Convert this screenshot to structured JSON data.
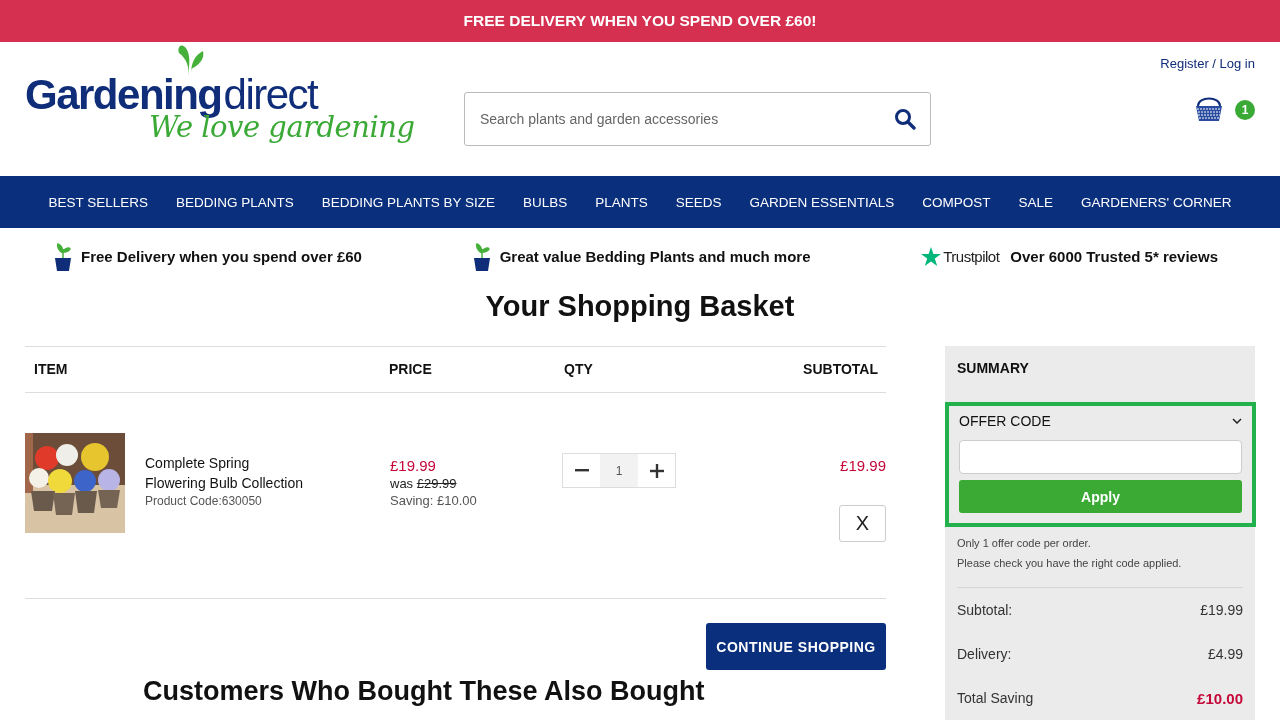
{
  "banner": {
    "text": "FREE DELIVERY WHEN YOU SPEND OVER £60!"
  },
  "header": {
    "logo": {
      "wordmark": "Gardening",
      "suffix": "direct",
      "tagline": "We love gardening"
    },
    "search": {
      "placeholder": "Search plants and garden accessories"
    },
    "account_link": "Register / Log in",
    "basket_count": "1"
  },
  "nav": [
    {
      "label": "BEST SELLERS"
    },
    {
      "label": "BEDDING PLANTS"
    },
    {
      "label": "BEDDING PLANTS BY SIZE"
    },
    {
      "label": "BULBS"
    },
    {
      "label": "PLANTS"
    },
    {
      "label": "SEEDS"
    },
    {
      "label": "GARDEN ESSENTIALS"
    },
    {
      "label": "COMPOST"
    },
    {
      "label": "SALE"
    },
    {
      "label": "GARDENERS' CORNER"
    }
  ],
  "usps": [
    {
      "kind": "plant",
      "text": "Free Delivery when you spend over £60"
    },
    {
      "kind": "plant",
      "text": "Great value Bedding Plants and much more"
    },
    {
      "kind": "trustpilot",
      "brand": "Trustpilot",
      "text": "Over 6000 Trusted 5* reviews"
    }
  ],
  "basket": {
    "title": "Your Shopping Basket",
    "columns": [
      "ITEM",
      "PRICE",
      "QTY",
      "SUBTOTAL"
    ],
    "items": [
      {
        "name": "Complete Spring Flowering Bulb Collection",
        "code": "Product Code:630050",
        "price": "£19.99",
        "was_label": "was",
        "was_price": "£29.99",
        "saving": "Saving: £10.00",
        "qty": "1",
        "subtotal": "£19.99",
        "remove": "X"
      }
    ],
    "continue_button": "CONTINUE SHOPPING"
  },
  "summary": {
    "title": "SUMMARY",
    "offer": {
      "label": "OFFER CODE",
      "expanded": true,
      "highlighted": true,
      "button": "Apply",
      "notes": [
        "Only 1 offer code per order.",
        "Please check you have the right code applied."
      ]
    },
    "totals": [
      {
        "label": "Subtotal:",
        "value": "£19.99",
        "emphasis": false
      },
      {
        "label": "Delivery:",
        "value": "£4.99",
        "emphasis": false
      },
      {
        "label": "Total Saving",
        "value": "£10.00",
        "emphasis": true
      }
    ]
  },
  "recommendations": {
    "title": "Customers Who Bought These Also Bought"
  }
}
